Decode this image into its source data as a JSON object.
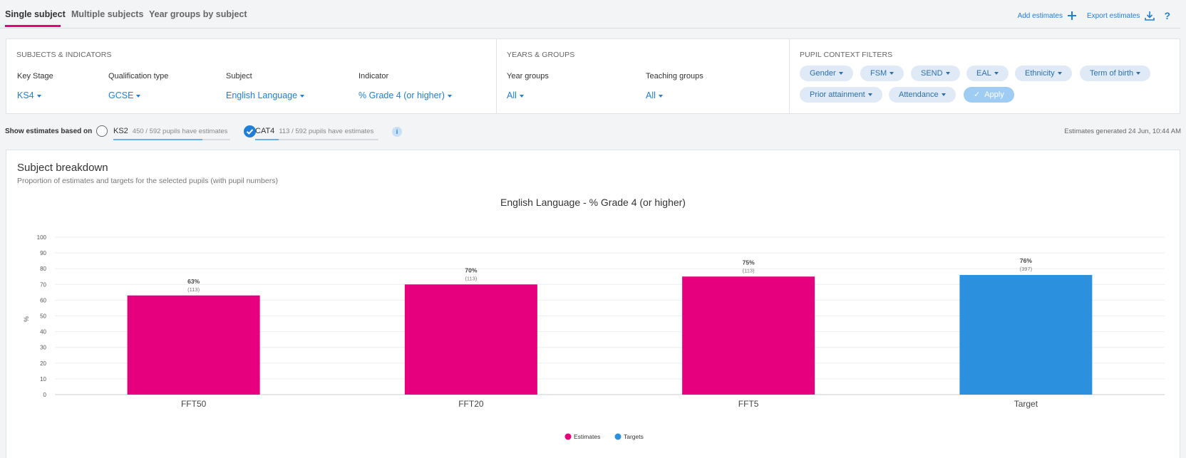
{
  "tabs": [
    {
      "label": "Single subject",
      "active": true
    },
    {
      "label": "Multiple subjects",
      "active": false
    },
    {
      "label": "Year groups by subject",
      "active": false
    }
  ],
  "actions": {
    "add": "Add estimates",
    "export": "Export estimates",
    "help": "?"
  },
  "subjects": {
    "title": "SUBJECTS & INDICATORS",
    "fields": [
      {
        "label": "Key Stage",
        "value": "KS4"
      },
      {
        "label": "Qualification type",
        "value": "GCSE"
      },
      {
        "label": "Subject",
        "value": "English Language"
      },
      {
        "label": "Indicator",
        "value": "% Grade 4 (or higher)"
      }
    ]
  },
  "years": {
    "title": "YEARS & GROUPS",
    "fields": [
      {
        "label": "Year groups",
        "value": "All"
      },
      {
        "label": "Teaching groups",
        "value": "All"
      }
    ]
  },
  "context": {
    "title": "PUPIL CONTEXT FILTERS",
    "pills": [
      "Gender",
      "FSM",
      "SEND",
      "EAL",
      "Ethnicity",
      "Term of birth",
      "Prior attainment",
      "Attendance"
    ],
    "apply": "Apply"
  },
  "estimates": {
    "label": "Show estimates based on",
    "options": [
      {
        "name": "KS2",
        "count": "450 / 592 pupils have estimates",
        "fraction": 0.76,
        "selected": false
      },
      {
        "name": "CAT4",
        "count": "113 / 592 pupils have estimates",
        "fraction": 0.19,
        "selected": true
      }
    ],
    "info": "i",
    "generated": "Estimates generated 24 Jun, 10:44 AM"
  },
  "card": {
    "title": "Subject breakdown",
    "subtitle": "Proportion of estimates and targets for the selected pupils (with pupil numbers)"
  },
  "chart_data": {
    "type": "bar",
    "title": "English Language - % Grade 4 (or higher)",
    "ylabel": "%",
    "xlabel": "",
    "ylim": [
      0,
      100
    ],
    "yticks": [
      0,
      10,
      20,
      30,
      40,
      50,
      60,
      70,
      80,
      90,
      100
    ],
    "categories": [
      "FFT50",
      "FFT20",
      "FFT5",
      "Target"
    ],
    "values": [
      63,
      70,
      75,
      76
    ],
    "value_labels": [
      "63%",
      "70%",
      "75%",
      "76%"
    ],
    "counts": [
      "(113)",
      "(113)",
      "(113)",
      "(397)"
    ],
    "series_of_bar": [
      "Estimates",
      "Estimates",
      "Estimates",
      "Targets"
    ],
    "legend": [
      {
        "name": "Estimates",
        "color": "#e6007e"
      },
      {
        "name": "Targets",
        "color": "#2b91df"
      }
    ],
    "legend_position": "bottom",
    "grid": true
  }
}
